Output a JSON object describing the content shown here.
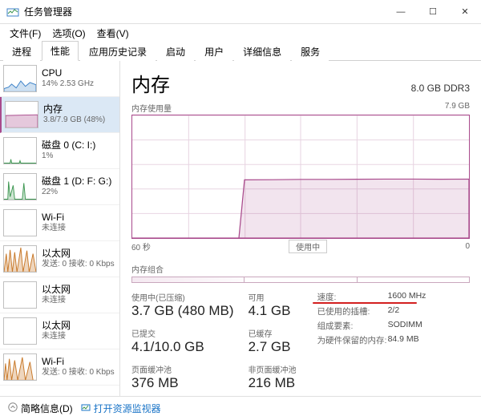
{
  "window": {
    "title": "任务管理器",
    "minimize": "—",
    "maximize": "☐",
    "close": "✕"
  },
  "menu": {
    "file": "文件(F)",
    "options": "选项(O)",
    "view": "查看(V)"
  },
  "tabs": [
    "进程",
    "性能",
    "应用历史记录",
    "启动",
    "用户",
    "详细信息",
    "服务"
  ],
  "active_tab_index": 1,
  "sidebar": {
    "items": [
      {
        "name": "CPU",
        "sub": "14% 2.53 GHz",
        "type": "cpu"
      },
      {
        "name": "内存",
        "sub": "3.8/7.9 GB (48%)",
        "type": "mem",
        "selected": true
      },
      {
        "name": "磁盘 0 (C: I:)",
        "sub": "1%",
        "type": "disk"
      },
      {
        "name": "磁盘 1 (D: F: G:)",
        "sub": "22%",
        "type": "disk"
      },
      {
        "name": "Wi-Fi",
        "sub": "未连接",
        "type": "net"
      },
      {
        "name": "以太网",
        "sub": "发送: 0 接收: 0 Kbps",
        "type": "net"
      },
      {
        "name": "以太网",
        "sub": "未连接",
        "type": "net"
      },
      {
        "name": "以太网",
        "sub": "未连接",
        "type": "net"
      },
      {
        "name": "Wi-Fi",
        "sub": "发送: 0 接收: 0 Kbps",
        "type": "net"
      }
    ]
  },
  "main": {
    "title": "内存",
    "capacity": "8.0 GB DDR3",
    "chart_label": "内存使用量",
    "chart_max": "7.9 GB",
    "x_left": "60 秒",
    "x_mid": "使用中",
    "x_right": "0",
    "slots_label": "内存组合"
  },
  "chart_data": {
    "type": "area",
    "title": "内存使用量",
    "xlabel": "秒",
    "ylabel": "GB",
    "xlim": [
      60,
      0
    ],
    "ylim": [
      0,
      7.9
    ],
    "series": [
      {
        "name": "使用中",
        "x": [
          60,
          55,
          50,
          45,
          42,
          41,
          40,
          35,
          30,
          25,
          20,
          15,
          10,
          5,
          0
        ],
        "y": [
          0,
          0,
          0,
          0,
          0,
          0,
          3.75,
          3.76,
          3.78,
          3.78,
          3.79,
          3.8,
          3.8,
          3.79,
          3.8
        ]
      }
    ]
  },
  "stats": {
    "used_label": "使用中(已压缩)",
    "used_value": "3.7 GB (480 MB)",
    "avail_label": "可用",
    "avail_value": "4.1 GB",
    "committed_label": "已提交",
    "committed_value": "4.1/10.0 GB",
    "cached_label": "已缓存",
    "cached_value": "2.7 GB",
    "paged_label": "页面缓冲池",
    "paged_value": "376 MB",
    "nonpaged_label": "非页面缓冲池",
    "nonpaged_value": "216 MB"
  },
  "details": {
    "speed_k": "速度:",
    "speed_v": "1600 MHz",
    "slots_k": "已使用的插槽:",
    "slots_v": "2/2",
    "form_k": "组成要素:",
    "form_v": "SODIMM",
    "hw_k": "为硬件保留的内存:",
    "hw_v": "84.9 MB"
  },
  "footer": {
    "fewer": "简略信息(D)",
    "resmon": "打开资源监视器"
  }
}
